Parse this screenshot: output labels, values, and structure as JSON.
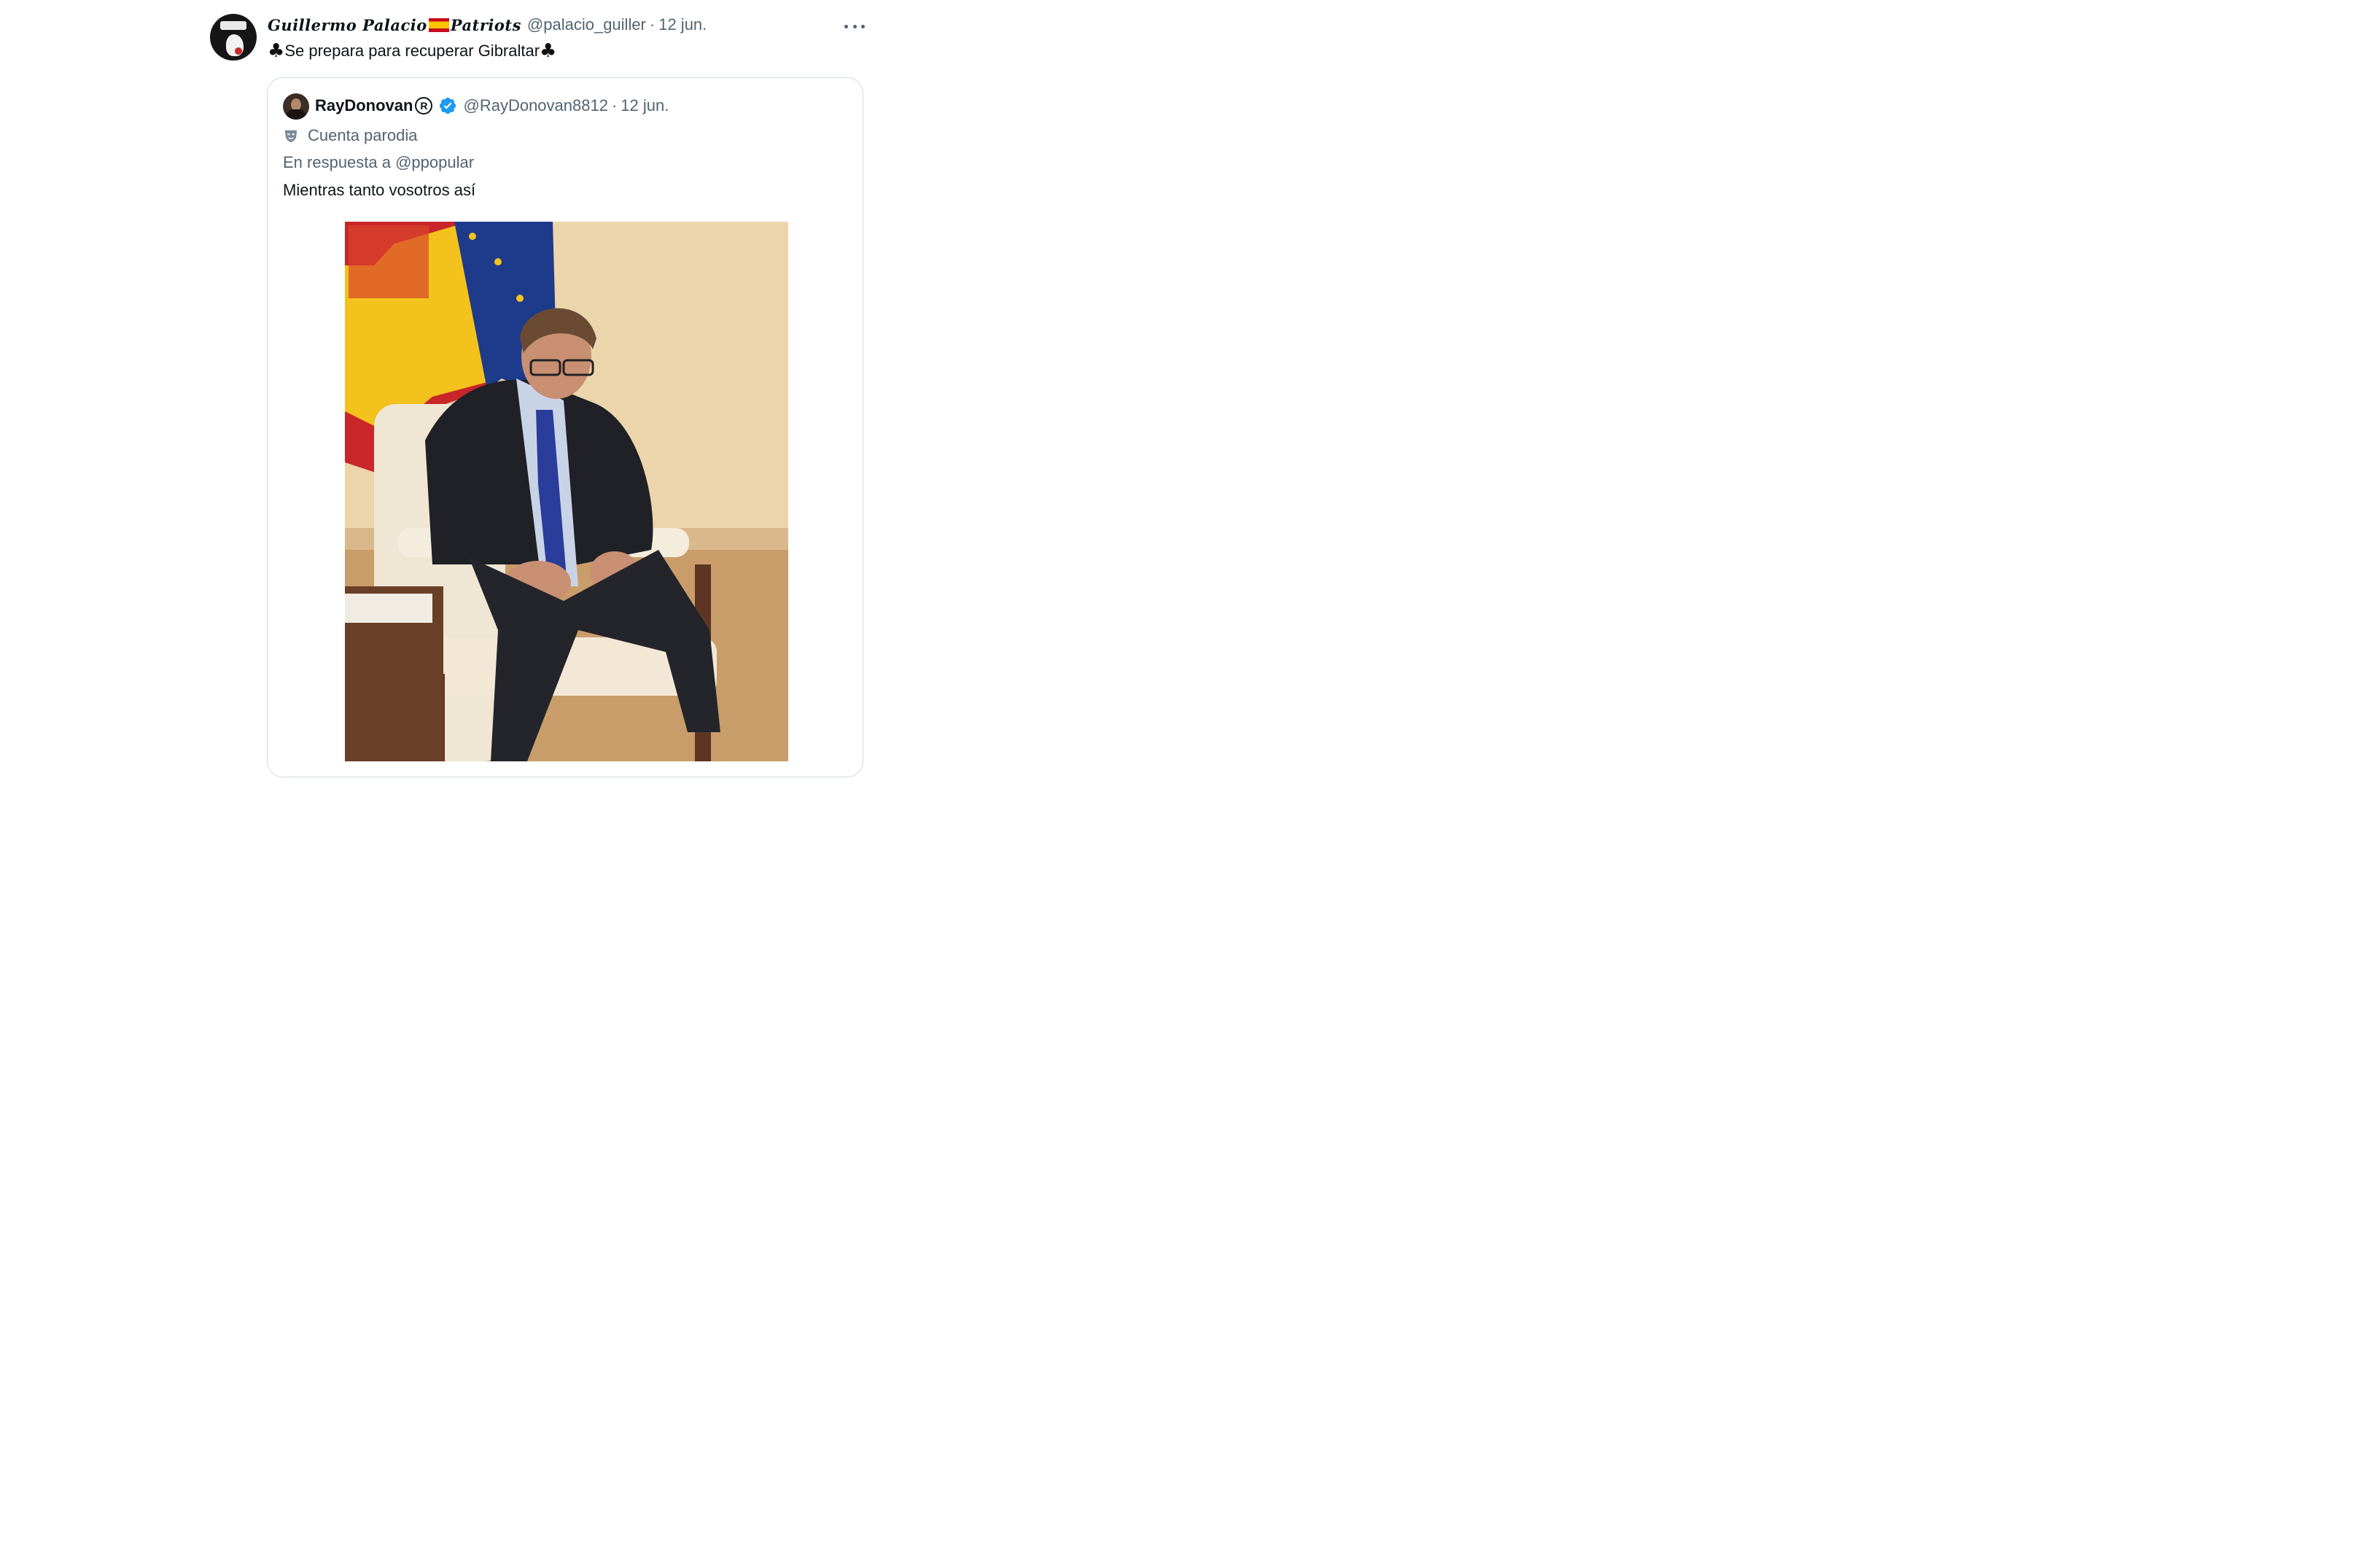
{
  "tweet": {
    "display_name_part1": "Guillermo Palacio",
    "display_name_flag": "spain-flag-emoji",
    "display_name_part2": "Patriots",
    "handle": "@palacio_guiller",
    "separator": "·",
    "date": "12 jun.",
    "text_prefix_icon": "club-suit-icon",
    "text": "Se prepara para recuperar Gibraltar",
    "text_suffix_icon": "club-suit-icon",
    "more_icon": "more-dots-icon"
  },
  "quoted": {
    "display_name": "RayDonovan",
    "registered_mark": "R",
    "verified_icon": "verified-badge-icon",
    "handle": "@RayDonovan8812",
    "separator": "·",
    "date": "12 jun.",
    "parody_label": "Cuenta parodia",
    "parody_icon": "mask-icon",
    "reply_context": "En respuesta a @ppopular",
    "text": "Mientras tanto vosotros así",
    "image_icon": "photo"
  },
  "colors": {
    "text_primary": "#0f1419",
    "text_muted": "#536471",
    "border": "#cfd9de",
    "verified_blue": "#1d9bf0"
  }
}
